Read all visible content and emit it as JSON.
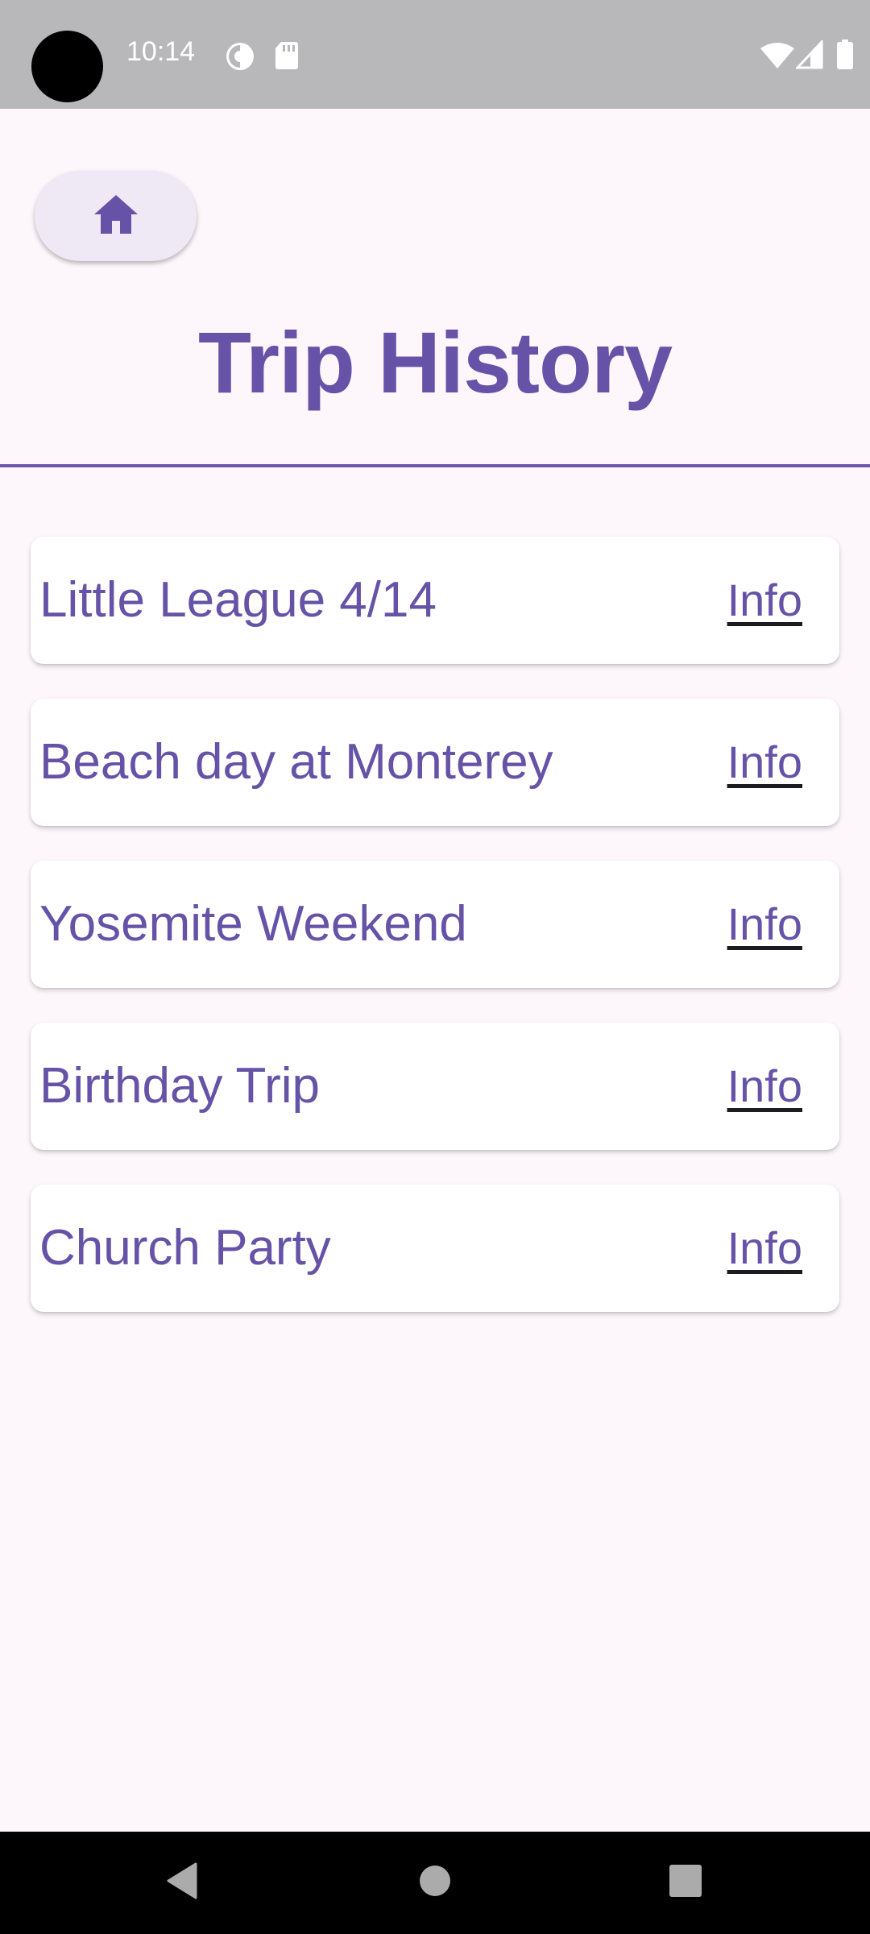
{
  "status_bar": {
    "time": "10:14",
    "icons": [
      "data-saver-icon",
      "sd-card-icon",
      "wifi-icon",
      "signal-icon",
      "battery-icon"
    ]
  },
  "header": {
    "home_icon": "home-icon",
    "title": "Trip History"
  },
  "trips": [
    {
      "name": "Little League 4/14",
      "link": "Info"
    },
    {
      "name": "Beach day at Monterey",
      "link": "Info"
    },
    {
      "name": "Yosemite Weekend",
      "link": "Info"
    },
    {
      "name": "Birthday Trip",
      "link": "Info"
    },
    {
      "name": "Church Party",
      "link": "Info"
    }
  ],
  "nav_bar": {
    "icons": [
      "back-icon",
      "home-circle-icon",
      "recents-icon"
    ]
  },
  "colors": {
    "accent": "#6652a7",
    "background": "#fdf7fc",
    "card": "#ffffff",
    "home_button": "#efe9f6",
    "status_bar": "#b8b7ba",
    "nav_bar": "#000000"
  }
}
